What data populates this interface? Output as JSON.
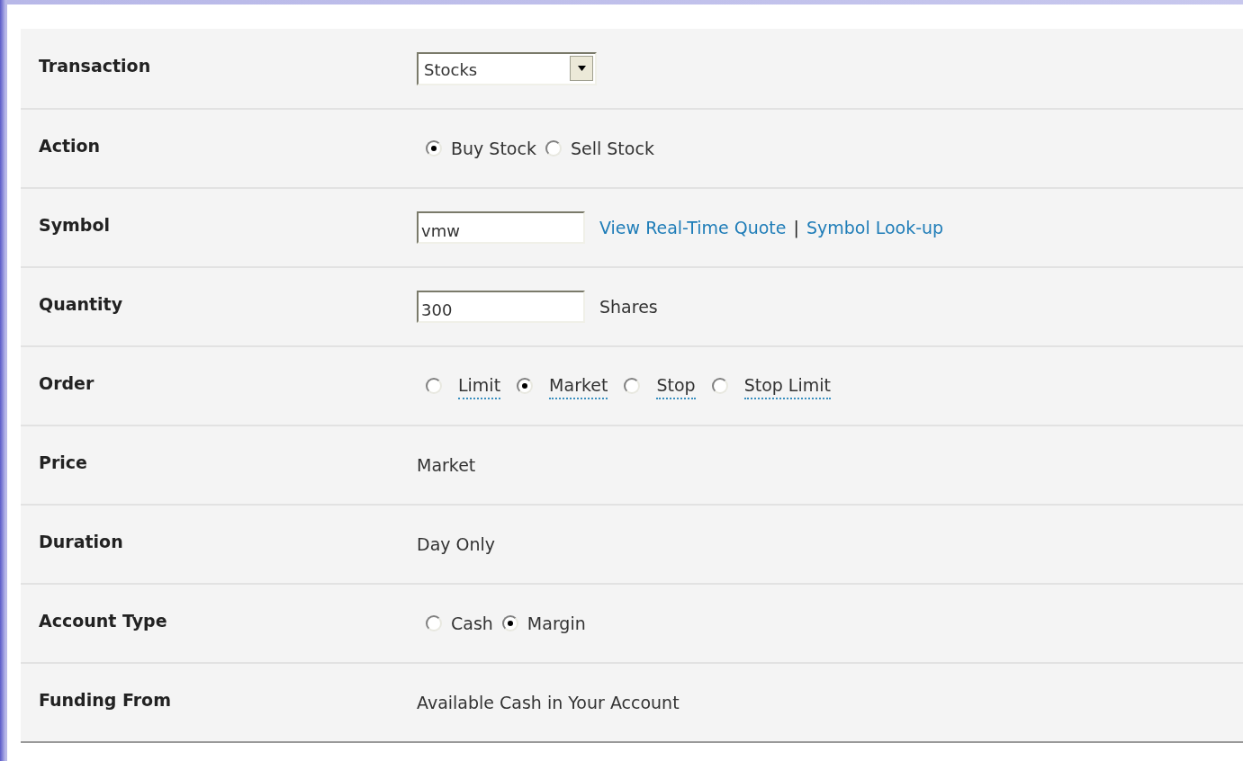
{
  "rows": [
    {
      "label": "Transaction",
      "kind": "select",
      "value": "Stocks"
    },
    {
      "label": "Action",
      "kind": "radios",
      "options": [
        {
          "label": "Buy Stock",
          "selected": true
        },
        {
          "label": "Sell Stock",
          "selected": false
        }
      ]
    },
    {
      "label": "Symbol",
      "kind": "input_links",
      "value": "vmw",
      "links": [
        "View Real-Time Quote",
        "Symbol Look-up"
      ],
      "separator": "|"
    },
    {
      "label": "Quantity",
      "kind": "input_suffix",
      "value": "300",
      "suffix": "Shares"
    },
    {
      "label": "Order",
      "kind": "radios_help",
      "options": [
        {
          "label": "Limit",
          "selected": false
        },
        {
          "label": "Market",
          "selected": true
        },
        {
          "label": "Stop",
          "selected": false
        },
        {
          "label": "Stop Limit",
          "selected": false
        }
      ]
    },
    {
      "label": "Price",
      "kind": "static",
      "value": "Market"
    },
    {
      "label": "Duration",
      "kind": "static",
      "value": "Day Only"
    },
    {
      "label": "Account Type",
      "kind": "radios",
      "options": [
        {
          "label": "Cash",
          "selected": false
        },
        {
          "label": "Margin",
          "selected": true
        }
      ]
    },
    {
      "label": "Funding From",
      "kind": "static",
      "value": "Available Cash in Your Account"
    }
  ]
}
